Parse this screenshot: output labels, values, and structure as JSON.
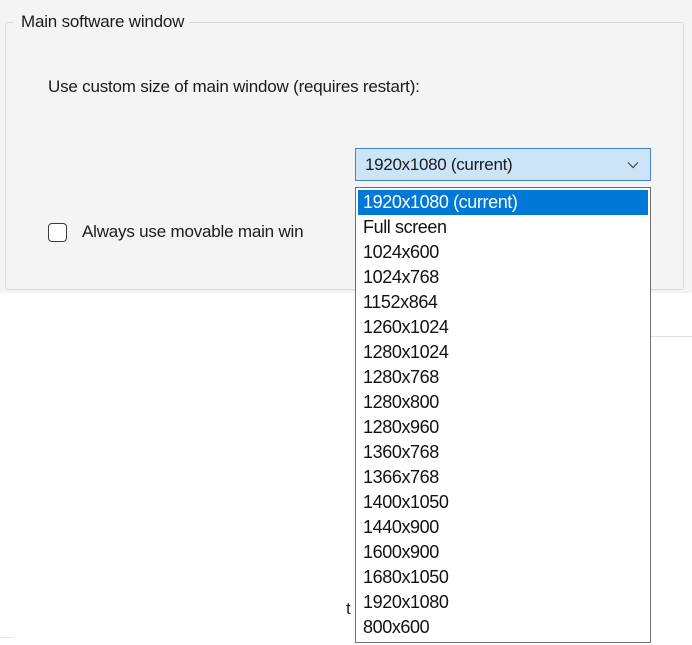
{
  "group": {
    "title": "Main software window"
  },
  "custom_size": {
    "label": "Use custom size of main window (requires restart):"
  },
  "resolution_select": {
    "selected_value": "1920x1080 (current)",
    "arrow_icon": "chevron-down-icon",
    "options": [
      "1920x1080 (current)",
      "Full screen",
      "1024x600",
      "1024x768",
      "1152x864",
      "1260x1024",
      "1280x1024",
      "1280x768",
      "1280x800",
      "1280x960",
      "1360x768",
      "1366x768",
      "1400x1050",
      "1440x900",
      "1600x900",
      "1680x1050",
      "1920x1080",
      "800x600"
    ],
    "highlighted_index": 0
  },
  "movable_checkbox": {
    "label": "Always use movable main win",
    "checked": false
  },
  "lower_area": {
    "partial_text": "t"
  },
  "colors": {
    "panel_background": "#f4f4f4",
    "selection_highlight": "#0078d7",
    "combobox_focus_background": "#cce4f7",
    "combobox_focus_border": "#3f87c9"
  }
}
